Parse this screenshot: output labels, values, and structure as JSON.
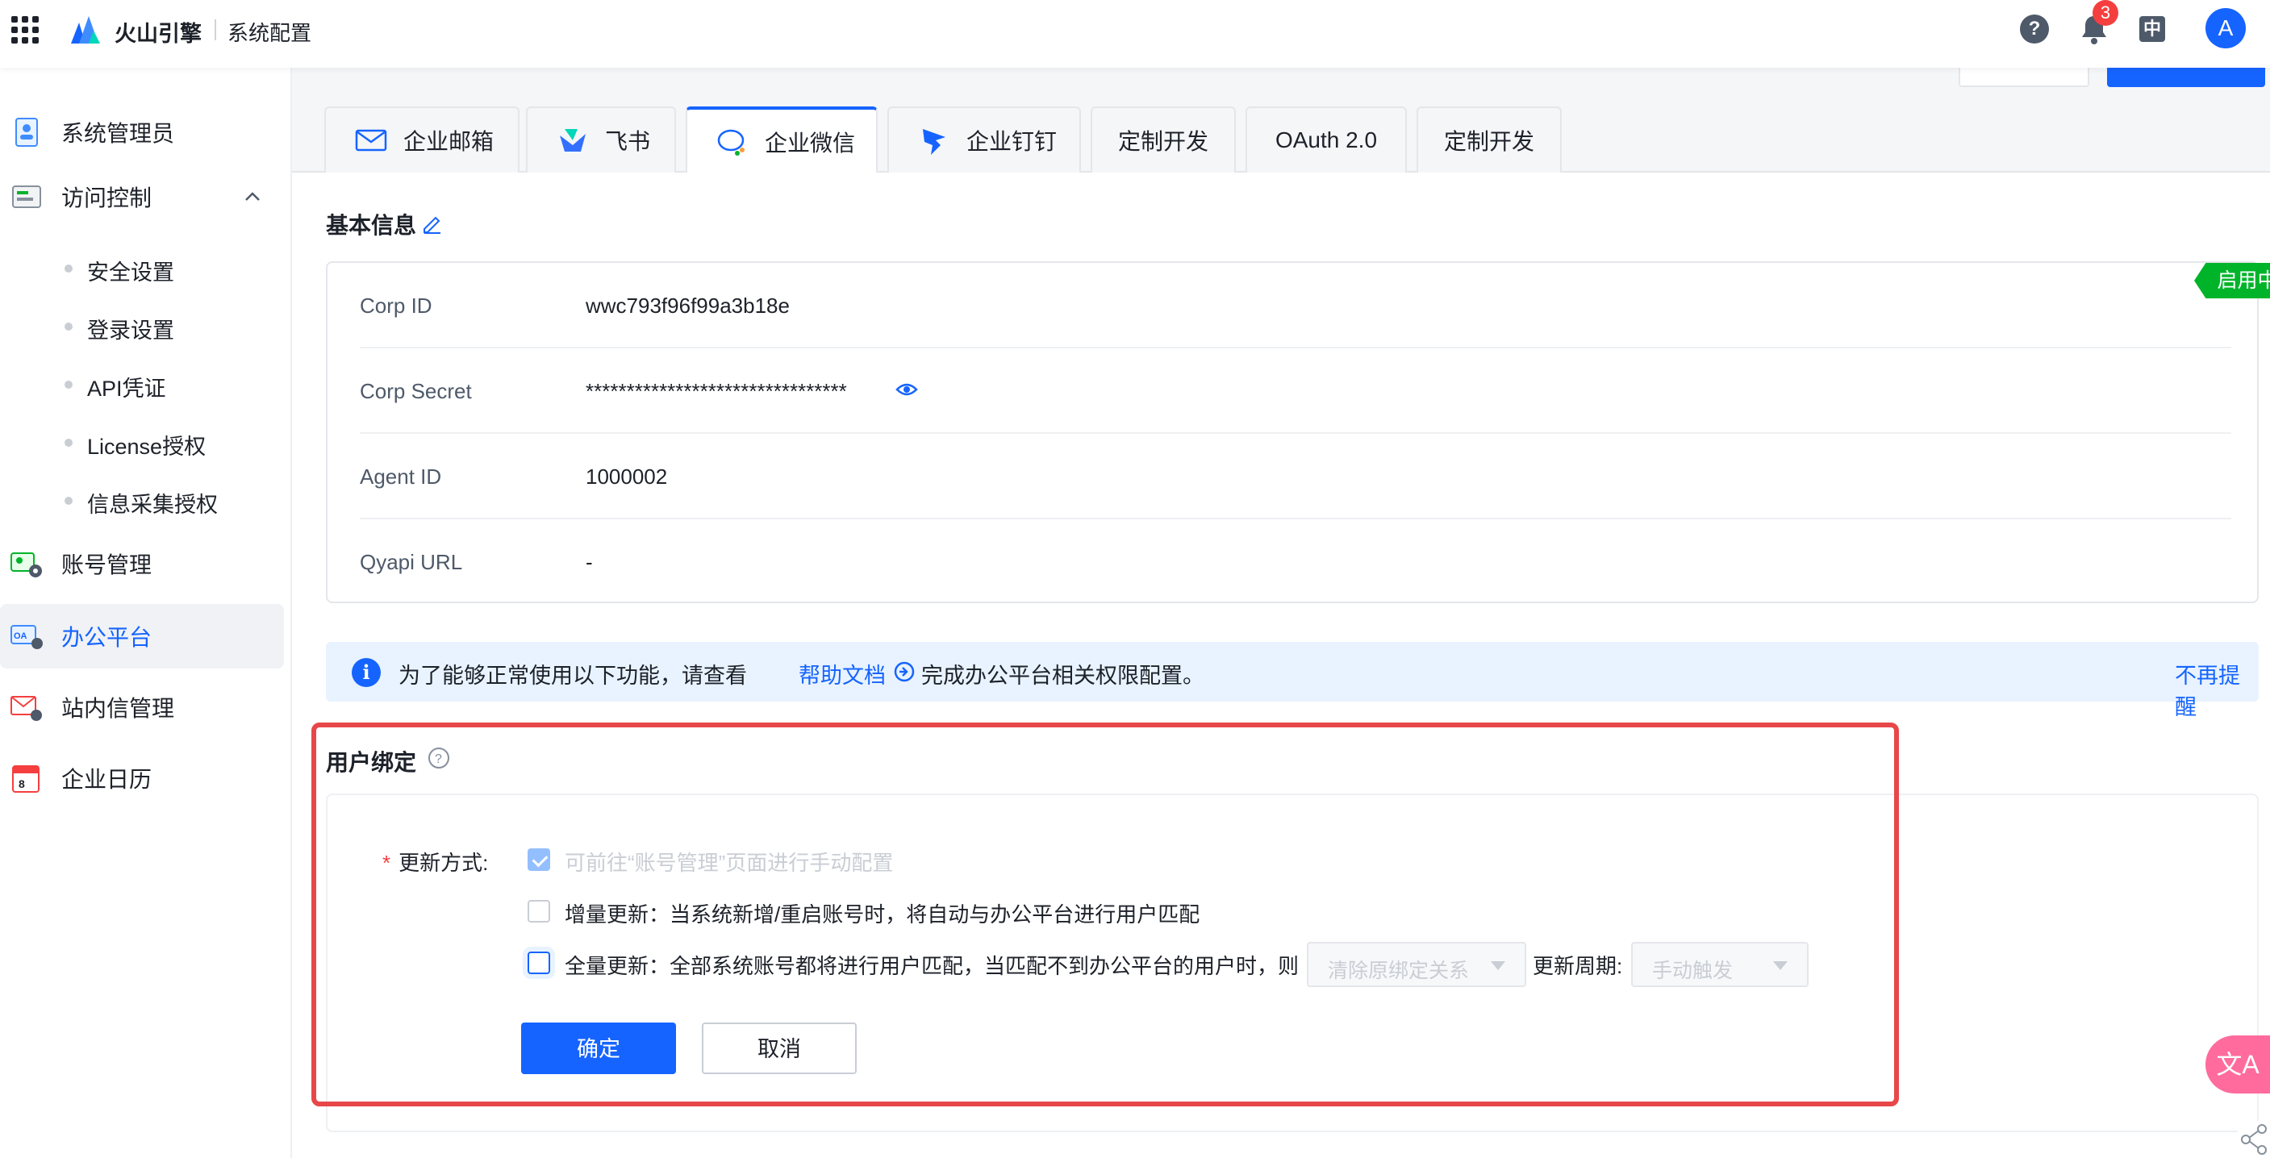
{
  "header": {
    "brand": "火山引擎",
    "system_title": "系统配置",
    "notification_count": "3",
    "lang": "中",
    "avatar": "A",
    "help": "?"
  },
  "sidebar": {
    "items": [
      {
        "label": "系统管理员",
        "icon": "admin-user-icon"
      },
      {
        "label": "访问控制",
        "icon": "access-control-icon"
      },
      {
        "label": "账号管理",
        "icon": "account-gear-icon"
      },
      {
        "label": "办公平台",
        "icon": "oa-icon"
      },
      {
        "label": "站内信管理",
        "icon": "mail-gear-icon"
      },
      {
        "label": "企业日历",
        "icon": "calendar-icon"
      }
    ],
    "sub_items": [
      "安全设置",
      "登录设置",
      "API凭证",
      "License授权",
      "信息采集授权"
    ]
  },
  "tabs": [
    {
      "label": "企业邮箱",
      "icon": "mail-icon"
    },
    {
      "label": "飞书",
      "icon": "feishu-icon"
    },
    {
      "label": "企业微信",
      "icon": "wecom-icon",
      "active": true
    },
    {
      "label": "企业钉钉",
      "icon": "dingtalk-icon"
    },
    {
      "label": "定制开发"
    },
    {
      "label": "OAuth 2.0"
    },
    {
      "label": "定制开发"
    }
  ],
  "basic_info": {
    "title": "基本信息",
    "status": "启用中",
    "rows": [
      {
        "key": "Corp ID",
        "value": "wwc793f96f99a3b18e"
      },
      {
        "key": "Corp Secret",
        "value": "********************************"
      },
      {
        "key": "Agent ID",
        "value": "1000002"
      },
      {
        "key": "Qyapi URL",
        "value": "-"
      }
    ]
  },
  "notice": {
    "text_before": "为了能够正常使用以下功能，请查看",
    "link": "帮助文档",
    "text_after": "完成办公平台相关权限配置。",
    "dismiss": "不再提醒"
  },
  "user_binding": {
    "title": "用户绑定",
    "update_mode_label": "更新方式:",
    "required_mark": "*",
    "options": [
      {
        "text": "可前往“账号管理”页面进行手动配置",
        "checked": true,
        "disabled": true
      },
      {
        "text": "增量更新：当系统新增/重启账号时，将自动与办公平台进行用户匹配",
        "checked": false
      },
      {
        "text": "全量更新：全部系统账号都将进行用户匹配，当匹配不到办公平台的用户时，则",
        "checked": false
      }
    ],
    "unmatched_action": "清除原绑定关系",
    "cycle_label": "更新周期:",
    "cycle_value": "手动触发",
    "confirm": "确定",
    "cancel": "取消"
  },
  "fab": {
    "translate": "文A"
  },
  "colors": {
    "primary": "#1664ff",
    "success": "#00b42a",
    "danger": "#f53f3f",
    "highlight_box": "#e84749"
  }
}
